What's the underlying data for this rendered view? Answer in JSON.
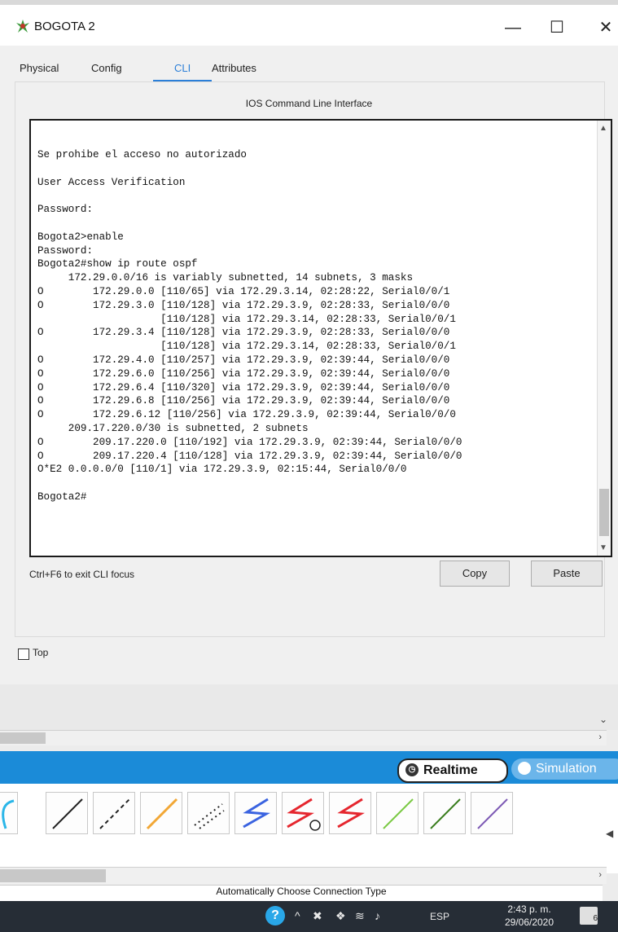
{
  "window": {
    "title": "BOGOTA 2",
    "minimize": "—",
    "maximize": "☐",
    "close": "✕"
  },
  "tabs": [
    {
      "label": "Physical"
    },
    {
      "label": "Config"
    },
    {
      "label": "CLI"
    },
    {
      "label": "Attributes"
    }
  ],
  "panel": {
    "title": "IOS Command Line Interface"
  },
  "cli": {
    "lines": [
      "Se prohibe el acceso no autorizado",
      "",
      "User Access Verification",
      "",
      "Password:",
      "",
      "Bogota2>enable",
      "Password:",
      "Bogota2#show ip route ospf",
      "     172.29.0.0/16 is variably subnetted, 14 subnets, 3 masks",
      "O        172.29.0.0 [110/65] via 172.29.3.14, 02:28:22, Serial0/0/1",
      "O        172.29.3.0 [110/128] via 172.29.3.9, 02:28:33, Serial0/0/0",
      "                    [110/128] via 172.29.3.14, 02:28:33, Serial0/0/1",
      "O        172.29.3.4 [110/128] via 172.29.3.9, 02:28:33, Serial0/0/0",
      "                    [110/128] via 172.29.3.14, 02:28:33, Serial0/0/1",
      "O        172.29.4.0 [110/257] via 172.29.3.9, 02:39:44, Serial0/0/0",
      "O        172.29.6.0 [110/256] via 172.29.3.9, 02:39:44, Serial0/0/0",
      "O        172.29.6.4 [110/320] via 172.29.3.9, 02:39:44, Serial0/0/0",
      "O        172.29.6.8 [110/256] via 172.29.3.9, 02:39:44, Serial0/0/0",
      "O        172.29.6.12 [110/256] via 172.29.3.9, 02:39:44, Serial0/0/0",
      "     209.17.220.0/30 is subnetted, 2 subnets",
      "O        209.17.220.0 [110/192] via 172.29.3.9, 02:39:44, Serial0/0/0",
      "O        209.17.220.4 [110/128] via 172.29.3.9, 02:39:44, Serial0/0/0",
      "O*E2 0.0.0.0/0 [110/1] via 172.29.3.9, 02:15:44, Serial0/0/0",
      "",
      "Bogota2#"
    ]
  },
  "footer": {
    "hint": "Ctrl+F6 to exit CLI focus",
    "copy_label": "Copy",
    "paste_label": "Paste",
    "top_label": "Top"
  },
  "mode_bar": {
    "realtime_label": "Realtime",
    "simulation_label": "Simulation"
  },
  "connection_tools": {
    "icons": [
      "console-cable-icon",
      "copper-straight-icon",
      "copper-cross-icon",
      "fiber-icon",
      "phone-cable-icon",
      "serial-dce-icon",
      "serial-dce-clock-icon",
      "serial-dte-icon",
      "octal-cable-icon",
      "iot-cable-icon",
      "usb-cable-icon"
    ],
    "colors": {
      "console": "#2ab6e8",
      "copper": "#222222",
      "fiber": "#f2a735",
      "serial": "#e5262e",
      "serial_dte": "#3a63e0",
      "octal": "#7ac943",
      "iot": "#3a7d1e",
      "usb": "#7d5ab5"
    },
    "status_text": "Automatically Choose Connection Type"
  },
  "taskbar": {
    "language": "ESP",
    "time": "2:43 p. m.",
    "date": "29/06/2020",
    "notifications": "6"
  }
}
